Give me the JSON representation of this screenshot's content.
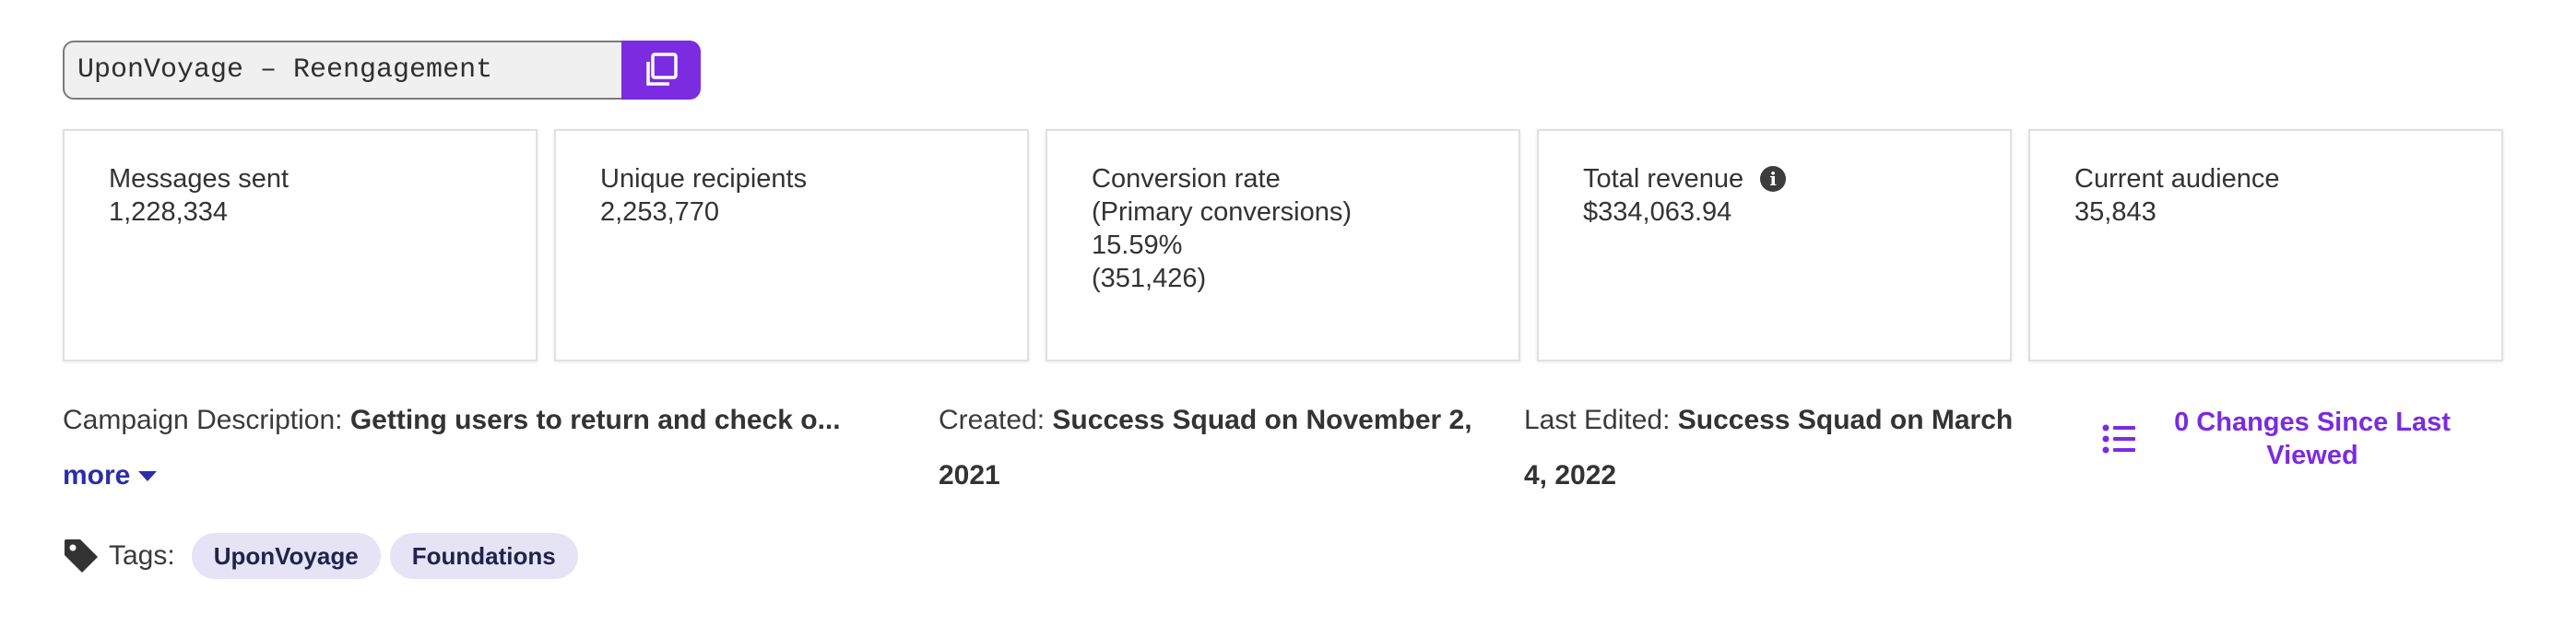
{
  "campaign": {
    "name": "UponVoyage – Reengagement",
    "copy_icon": "copy-icon"
  },
  "stats": [
    {
      "label": "Messages sent",
      "lines": [
        "1,228,334"
      ]
    },
    {
      "label": "Unique recipients",
      "lines": [
        "2,253,770"
      ]
    },
    {
      "label": "Conversion rate",
      "lines": [
        "(Primary conversions)",
        "15.59%",
        "(351,426)"
      ]
    },
    {
      "label": "Total revenue",
      "lines": [
        "$334,063.94"
      ],
      "icon": "info-icon"
    },
    {
      "label": "Current audience",
      "lines": [
        "35,843"
      ]
    }
  ],
  "meta": {
    "description_label": "Campaign Description:",
    "description_value": "Getting users to return and check o...",
    "more_label": "more",
    "created_label": "Created:",
    "created_value": "Success Squad on November 2, 2021",
    "edited_label": "Last Edited:",
    "edited_value": "Success Squad on March 4, 2022",
    "changes_label": "0 Changes Since Last Viewed",
    "changes_icon": "list-icon"
  },
  "tags": {
    "label": "Tags:",
    "icon": "tag-icon",
    "items": [
      "UponVoyage",
      "Foundations"
    ]
  },
  "colors": {
    "accent": "#7b2be0",
    "link": "#2b2ea8",
    "tag_bg": "#e6e3f7"
  }
}
